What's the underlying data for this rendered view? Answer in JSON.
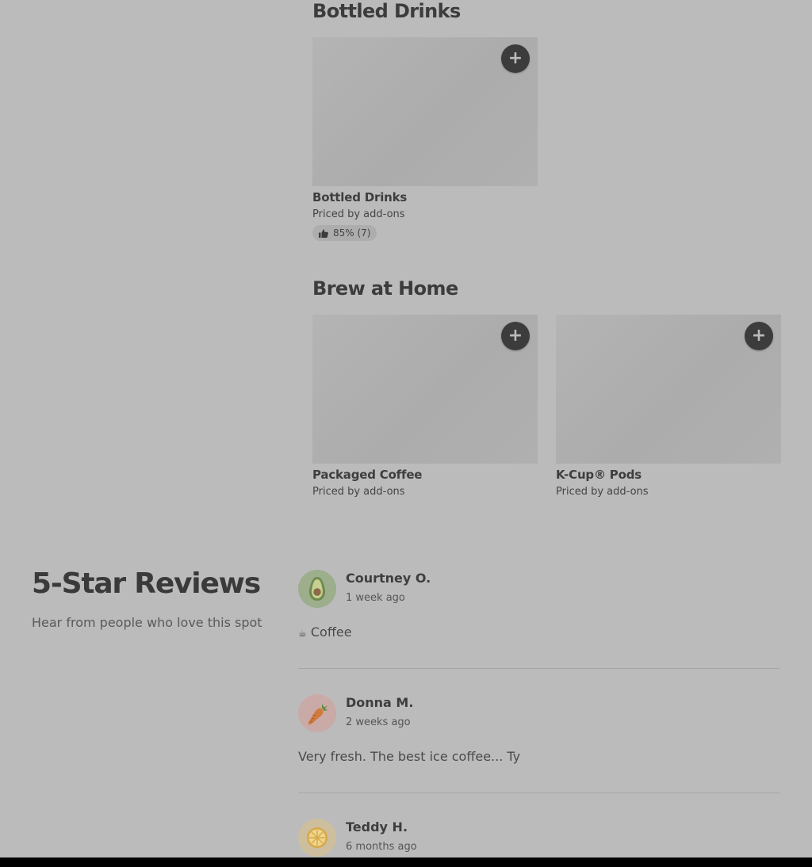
{
  "sections": {
    "bottled_drinks": {
      "title": "Bottled Drinks",
      "items": [
        {
          "name": "Bottled Drinks",
          "price": "Priced by add-ons",
          "rating": "85% (7)"
        }
      ]
    },
    "brew_at_home": {
      "title": "Brew at Home",
      "items": [
        {
          "name": "Packaged Coffee",
          "price": "Priced by add-ons"
        },
        {
          "name": "K-Cup® Pods",
          "price": "Priced by add-ons"
        }
      ]
    }
  },
  "add_button_label": "+",
  "icons": {
    "add": "plus-icon",
    "rating": "thumbs-up-icon",
    "avatar_1": "avocado-icon",
    "avatar_2": "carrot-icon",
    "avatar_3": "citrus-icon",
    "review_1_emoji": "coffee-cup-icon"
  },
  "reviews": {
    "title": "5-Star Reviews",
    "subtitle": "Hear from people who love this spot",
    "items": [
      {
        "name": "Courtney O.",
        "time": "1 week ago",
        "text": "Coffee",
        "emoji": "☕"
      },
      {
        "name": "Donna M.",
        "time": "2 weeks ago",
        "text": "Very fresh. The best ice coffee... Ty"
      },
      {
        "name": "Teddy H.",
        "time": "6 months ago"
      }
    ]
  },
  "colors": {
    "background": "#bbbbbb",
    "button": "#3c3c3c",
    "avatar_green": "#9cae8c",
    "avatar_pink": "#c9aaa7",
    "avatar_yellow": "#cdbf9e"
  }
}
